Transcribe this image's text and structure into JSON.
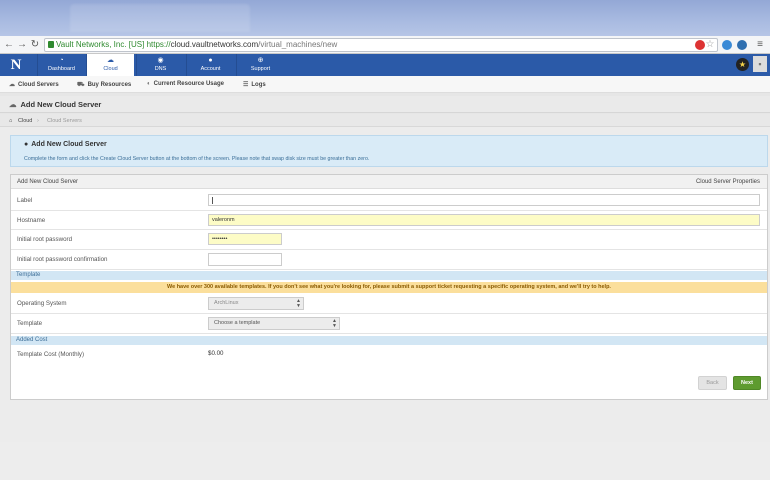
{
  "browser": {
    "url_org": "Vault Networks, Inc. [US]",
    "url_scheme": "https://",
    "url_host": "cloud.vaultnetworks.com",
    "url_path": "/virtual_machines/new"
  },
  "nav": {
    "tabs": [
      {
        "label": "Dashboard",
        "icon": "dashboard-icon"
      },
      {
        "label": "Cloud",
        "icon": "cloud-icon"
      },
      {
        "label": "DNS",
        "icon": "dns-icon"
      },
      {
        "label": "Account",
        "icon": "account-icon"
      },
      {
        "label": "Support",
        "icon": "support-icon"
      }
    ],
    "active": "Cloud"
  },
  "subnav": {
    "items": [
      {
        "label": "Cloud Servers",
        "icon": "cloud-icon"
      },
      {
        "label": "Buy Resources",
        "icon": "cart-icon"
      },
      {
        "label": "Current Resource Usage",
        "icon": "gauge-icon"
      },
      {
        "label": "Logs",
        "icon": "list-icon"
      }
    ]
  },
  "page": {
    "title": "Add New Cloud Server",
    "breadcrumb": [
      "Cloud",
      "Cloud Servers"
    ]
  },
  "info": {
    "title": "Add New Cloud Server",
    "text": "Complete the form and click the Create Cloud Server button at the bottom of the screen. Please note that swap disk size must be greater than zero."
  },
  "panel": {
    "title_left": "Add New Cloud Server",
    "title_right": "Cloud Server Properties"
  },
  "form": {
    "label_label": "Label",
    "label_value": "",
    "hostname_label": "Hostname",
    "hostname_value": "valeronm",
    "password_label": "Initial root password",
    "password_value": "••••••••",
    "password_confirm_label": "Initial root password confirmation",
    "password_confirm_value": ""
  },
  "template_section": {
    "title": "Template",
    "notice": "We have over 300 available templates. If you don't see what you're looking for, please submit a support ticket requesting a specific operating system, and we'll try to help.",
    "os_label": "Operating System",
    "os_value": "ArchLinux",
    "template_label": "Template",
    "template_value": "Choose a template"
  },
  "cost_section": {
    "title": "Added Cost",
    "cost_label": "Template Cost (Monthly)",
    "cost_value": "$0.00"
  },
  "actions": {
    "back_label": "Back",
    "next_label": "Next"
  },
  "colors": {
    "nav_bg": "#2b5aa8",
    "info_bg": "#d9ebf7",
    "warn_bg": "#fbdf9c",
    "next_btn": "#5e9b2f"
  }
}
